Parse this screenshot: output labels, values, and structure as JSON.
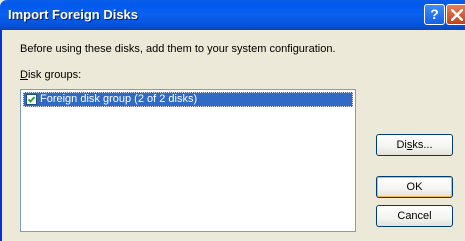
{
  "window": {
    "title": "Import Foreign Disks",
    "help_glyph": "?",
    "title_icons": [
      "help-icon",
      "close-icon"
    ]
  },
  "instruction": "Before using these disks, add them to your system configuration.",
  "disk_groups": {
    "label_mnemonic": "D",
    "label_rest": "isk groups:",
    "items": [
      {
        "label": "Foreign disk group (2 of 2 disks)",
        "checked": true,
        "selected": true
      }
    ]
  },
  "buttons": {
    "disks_pre": "Di",
    "disks_mnemonic": "s",
    "disks_post": "ks...",
    "ok": "OK",
    "cancel": "Cancel"
  },
  "colors": {
    "titlebar": "#0058EE",
    "selection": "#316AC5",
    "dialog_bg": "#ECE9D8",
    "close_button": "#C5401A"
  }
}
